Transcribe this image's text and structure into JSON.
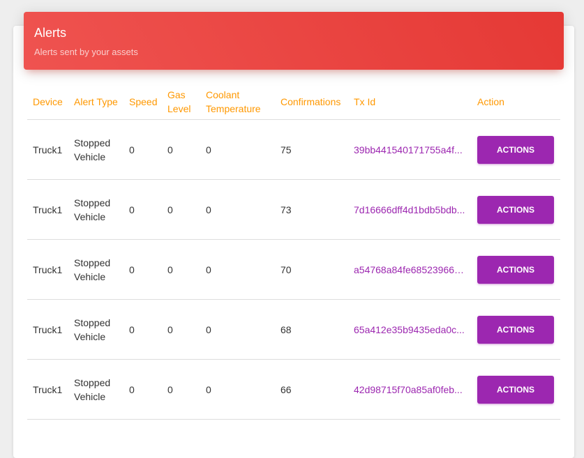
{
  "header": {
    "title": "Alerts",
    "subtitle": "Alerts sent by your assets"
  },
  "colors": {
    "header_gradient_start": "#ef5350",
    "header_gradient_end": "#e53935",
    "column_header": "#ff9800",
    "tx_link": "#9c27b0",
    "action_button": "#9c27b0"
  },
  "table": {
    "columns": [
      "Device",
      "Alert Type",
      "Speed",
      "Gas Level",
      "Coolant Temperature",
      "Confirmations",
      "Tx Id",
      "Action"
    ],
    "rows": [
      {
        "device": "Truck1",
        "alert_type": "Stopped Vehicle",
        "speed": "0",
        "gas_level": "0",
        "coolant": "0",
        "confirmations": "75",
        "tx_id": "39bb441540171755a4f...",
        "action": "ACTIONS"
      },
      {
        "device": "Truck1",
        "alert_type": "Stopped Vehicle",
        "speed": "0",
        "gas_level": "0",
        "coolant": "0",
        "confirmations": "73",
        "tx_id": "7d16666dff4d1bdb5bdb...",
        "action": "ACTIONS"
      },
      {
        "device": "Truck1",
        "alert_type": "Stopped Vehicle",
        "speed": "0",
        "gas_level": "0",
        "coolant": "0",
        "confirmations": "70",
        "tx_id": "a54768a84fe68523966d...",
        "action": "ACTIONS"
      },
      {
        "device": "Truck1",
        "alert_type": "Stopped Vehicle",
        "speed": "0",
        "gas_level": "0",
        "coolant": "0",
        "confirmations": "68",
        "tx_id": "65a412e35b9435eda0c...",
        "action": "ACTIONS"
      },
      {
        "device": "Truck1",
        "alert_type": "Stopped Vehicle",
        "speed": "0",
        "gas_level": "0",
        "coolant": "0",
        "confirmations": "66",
        "tx_id": "42d98715f70a85af0feb...",
        "action": "ACTIONS"
      }
    ]
  }
}
